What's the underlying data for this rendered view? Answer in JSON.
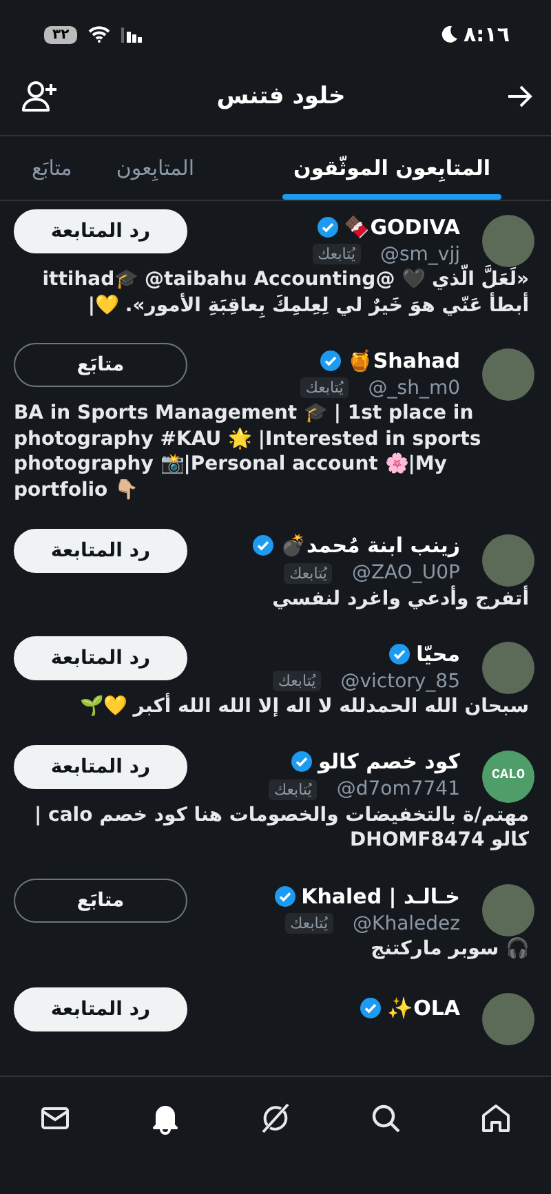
{
  "status_bar": {
    "time": "٨:١٦",
    "battery": "٣٢",
    "dark_mode": true
  },
  "header": {
    "title": "خلود فتنس"
  },
  "tabs": [
    {
      "label": "المتابِعون الموثّقون",
      "selected": true
    },
    {
      "label": "المتابِعون",
      "selected": false
    },
    {
      "label": "متابَع",
      "selected": false
    }
  ],
  "users": [
    {
      "name": "GODIVA🍫",
      "verified": true,
      "handle": "@sm_vjj",
      "follows_you": "يُتابعك",
      "button": {
        "label": "رد المتابعة",
        "kind": "follow_back"
      },
      "bio": "«لَعَلَّ الّذي 🖤 @ittihad🎓 @taibahu Accounting أبطأ عَنّي هوَ خَيرٌ لي لِعِلمِكَ بِعاقِبَةِ الأمور». 💛|",
      "avatar": {
        "kind": "photo"
      }
    },
    {
      "name": "Shahad🍯",
      "verified": true,
      "handle": "@_sh_m0",
      "follows_you": "يُتابعك",
      "button": {
        "label": "متابَع",
        "kind": "following"
      },
      "bio": "BA in Sports Management 🎓 | 1st place in photography #KAU 🌟 |Interested in sports photography 📸|Personal account 🌸|My portfolio 👇🏼",
      "avatar": {
        "kind": "photo"
      }
    },
    {
      "name": "زينب ابنة مُحمد💣",
      "verified": true,
      "handle": "@ZAO_U0P",
      "follows_you": "يُتابعك",
      "button": {
        "label": "رد المتابعة",
        "kind": "follow_back"
      },
      "bio": "أتفرج وأدعي واغرد لنفسي",
      "avatar": {
        "kind": "photo"
      }
    },
    {
      "name": "محيّا",
      "verified": true,
      "handle": "@victory_85",
      "follows_you": "يُتابعك",
      "button": {
        "label": "رد المتابعة",
        "kind": "follow_back"
      },
      "bio": "سبحان الله الحمدلله لا اله إلا الله الله أكبر 💛🌱",
      "avatar": {
        "kind": "photo"
      }
    },
    {
      "name": "كود خصم كالو",
      "verified": true,
      "handle": "@d7om7741",
      "follows_you": "يُتابعك",
      "button": {
        "label": "رد المتابعة",
        "kind": "follow_back"
      },
      "bio": "مهتم/ة بالتخفيضات والخصومات هنا كود خصم calo | كالو DHOMF8474",
      "avatar": {
        "kind": "logo",
        "text": "CALO"
      }
    },
    {
      "name": "خـالـد | Khaled",
      "verified": true,
      "handle": "@Khaledez",
      "follows_you": "يُتابعك",
      "button": {
        "label": "متابَع",
        "kind": "following"
      },
      "bio": "🎧 سوبر ماركتنج",
      "avatar": {
        "kind": "photo"
      }
    },
    {
      "name": "OLA✨",
      "verified": true,
      "button": {
        "label": "رد المتابعة",
        "kind": "follow_back"
      },
      "avatar": {
        "kind": "photo"
      }
    }
  ],
  "bottom_nav": [
    {
      "kind": "mail",
      "selected": false
    },
    {
      "kind": "bell",
      "selected": true
    },
    {
      "kind": "grok",
      "selected": false
    },
    {
      "kind": "search",
      "selected": false
    },
    {
      "kind": "home",
      "selected": false
    }
  ]
}
